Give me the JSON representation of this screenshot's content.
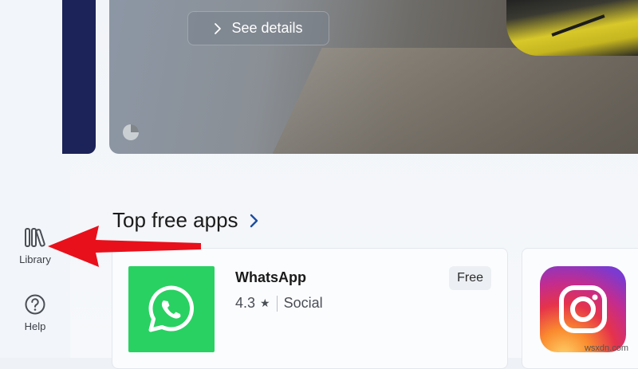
{
  "sidebar": {
    "items": [
      {
        "label": "Library",
        "icon": "library-icon"
      },
      {
        "label": "Help",
        "icon": "help-icon"
      }
    ]
  },
  "hero": {
    "details_label": "See details",
    "logo_icon": "game-logo-icon"
  },
  "section": {
    "title": "Top free apps",
    "more_icon": "chevron-right-icon"
  },
  "apps": [
    {
      "name": "WhatsApp",
      "rating": "4.3",
      "category": "Social",
      "price": "Free",
      "icon": "whatsapp-icon",
      "color": "#29d162"
    },
    {
      "name": "",
      "icon": "instagram-icon"
    }
  ],
  "annotation": {
    "icon": "red-arrow-icon",
    "color": "#e8101b"
  },
  "watermark": "wsxdn.com"
}
